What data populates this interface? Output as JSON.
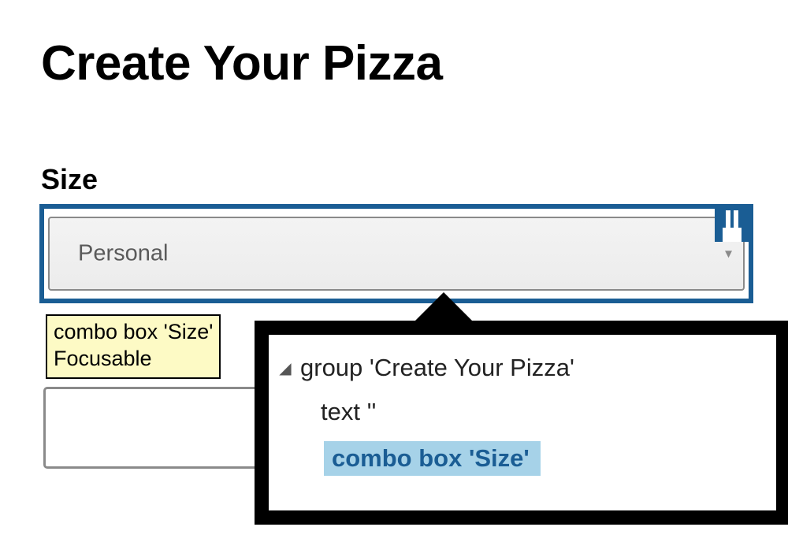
{
  "title": "Create Your Pizza",
  "size_label": "Size",
  "combo_value": "Personal",
  "tooltip_line1": "combo box 'Size'",
  "tooltip_line2": "Focusable",
  "inspector": {
    "row1": "group 'Create Your Pizza'",
    "row2": "text ''",
    "row3": "combo box 'Size'"
  }
}
